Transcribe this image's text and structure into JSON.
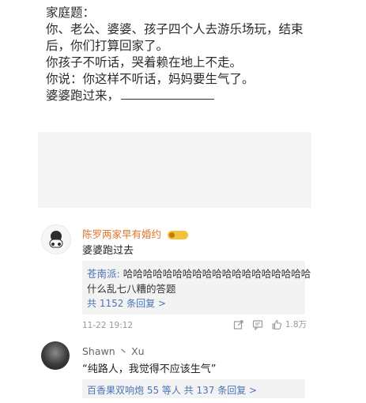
{
  "post": {
    "lines": [
      "家庭题：",
      "你、老公、婆婆、孩子四个人去游乐场玩，结束",
      "后，你们打算回家了。",
      "你孩子不听话，哭着赖在地上不走。",
      "你说：你这样不听话，妈妈要生气了。",
      "婆婆跑过来，"
    ]
  },
  "comments": [
    {
      "author": "陈罗两家早有婚约",
      "text": "婆婆跑过去",
      "reply": {
        "user": "苍南派:",
        "text1": "哈哈哈哈哈哈哈哈哈哈哈哈哈哈哈哈哈哈哈",
        "text2": "什么乱七八糟的答题",
        "more": "共 1152 条回复 >"
      },
      "time": "11-22 19:12",
      "likes": "1.8万"
    },
    {
      "author": "Shawn 丶 Xu",
      "text": "“纯路人，我觉得不应该生气”",
      "reply": {
        "summary": "百香果双响炮 55 等人 共 137 条回复 >"
      }
    }
  ],
  "icons": {
    "share": "share-icon",
    "comment": "comment-icon",
    "like": "like-icon"
  },
  "colors": {
    "author_accent": "#e0752a",
    "link": "#4a74b5",
    "reply_bg": "#f3f3f3"
  }
}
